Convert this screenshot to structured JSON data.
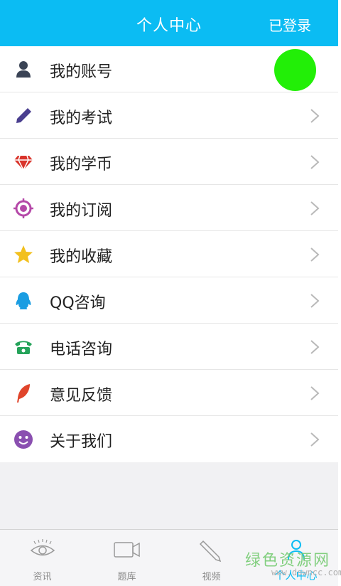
{
  "header": {
    "title": "个人中心",
    "login_status": "已登录"
  },
  "menu": {
    "items": [
      {
        "label": "我的账号",
        "icon": "user-icon",
        "color": "#3a4355"
      },
      {
        "label": "我的考试",
        "icon": "pencil-icon",
        "color": "#4a3f8f"
      },
      {
        "label": "我的学币",
        "icon": "diamond-icon",
        "color": "#d9342b"
      },
      {
        "label": "我的订阅",
        "icon": "target-icon",
        "color": "#b548a8"
      },
      {
        "label": "我的收藏",
        "icon": "star-icon",
        "color": "#f2c01e"
      },
      {
        "label": "QQ咨询",
        "icon": "qq-penguin-icon",
        "color": "#1a9de2"
      },
      {
        "label": "电话咨询",
        "icon": "phone-icon",
        "color": "#25a35a"
      },
      {
        "label": "意见反馈",
        "icon": "feather-icon",
        "color": "#e0452b"
      },
      {
        "label": "关于我们",
        "icon": "smiley-icon",
        "color": "#8a4fb0"
      }
    ]
  },
  "tabbar": {
    "tabs": [
      {
        "label": "资讯",
        "icon": "eye-icon"
      },
      {
        "label": "题库",
        "icon": "video-camera-icon"
      },
      {
        "label": "视频",
        "icon": "pencil-outline-icon"
      },
      {
        "label": "个人中心",
        "icon": "person-icon",
        "active": true
      }
    ]
  },
  "watermark": {
    "text": "绿色资源网",
    "url": "www.downcc.com"
  },
  "colors": {
    "accent": "#0bbcf3",
    "green_dot": "#22ef07"
  }
}
